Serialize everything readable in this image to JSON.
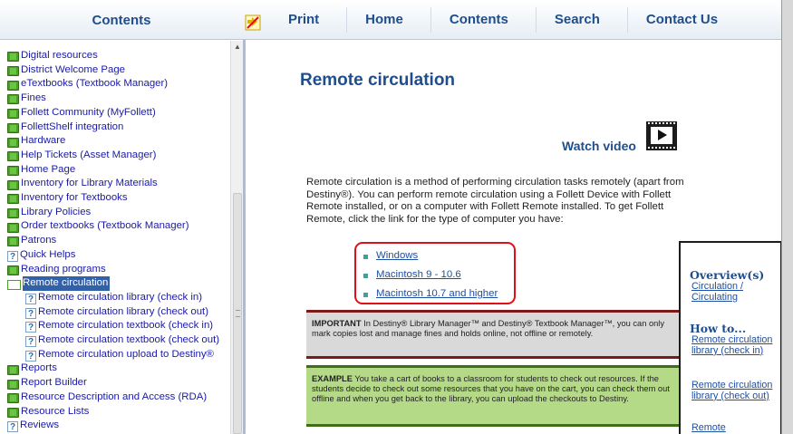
{
  "header": {
    "contents_label": "Contents",
    "nav": [
      "Print",
      "Home",
      "Contents",
      "Search",
      "Contact Us"
    ]
  },
  "sidebar": {
    "items": [
      {
        "label": "Digital resources",
        "icon": "book-icon",
        "level": 0
      },
      {
        "label": "District Welcome Page",
        "icon": "book-icon",
        "level": 0
      },
      {
        "label": "eTextbooks (Textbook Manager)",
        "icon": "book-icon",
        "level": 0
      },
      {
        "label": "Fines",
        "icon": "book-icon",
        "level": 0
      },
      {
        "label": "Follett Community (MyFollett)",
        "icon": "book-icon",
        "level": 0
      },
      {
        "label": "FollettShelf integration",
        "icon": "book-icon",
        "level": 0
      },
      {
        "label": "Hardware",
        "icon": "book-icon",
        "level": 0
      },
      {
        "label": "Help Tickets (Asset Manager)",
        "icon": "book-icon",
        "level": 0
      },
      {
        "label": "Home Page",
        "icon": "book-icon",
        "level": 0
      },
      {
        "label": "Inventory for Library Materials",
        "icon": "book-icon",
        "level": 0
      },
      {
        "label": "Inventory for Textbooks",
        "icon": "book-icon",
        "level": 0
      },
      {
        "label": "Library Policies",
        "icon": "book-icon",
        "level": 0
      },
      {
        "label": "Order textbooks (Textbook Manager)",
        "icon": "book-icon",
        "level": 0
      },
      {
        "label": "Patrons",
        "icon": "book-icon",
        "level": 0
      },
      {
        "label": "Quick Helps",
        "icon": "topic-icon",
        "level": 0
      },
      {
        "label": "Reading programs",
        "icon": "book-icon",
        "level": 0
      },
      {
        "label": "Remote circulation",
        "icon": "open-book-icon",
        "level": 0,
        "selected": true
      },
      {
        "label": "Remote circulation library (check in)",
        "icon": "topic-icon",
        "level": 1
      },
      {
        "label": "Remote circulation library (check out)",
        "icon": "topic-icon",
        "level": 1
      },
      {
        "label": "Remote circulation textbook (check in)",
        "icon": "topic-icon",
        "level": 1
      },
      {
        "label": "Remote circulation textbook (check out)",
        "icon": "topic-icon",
        "level": 1
      },
      {
        "label": "Remote circulation upload to Destiny®",
        "icon": "topic-icon",
        "level": 1
      },
      {
        "label": "Reports",
        "icon": "book-icon",
        "level": 0
      },
      {
        "label": "Report Builder",
        "icon": "book-icon",
        "level": 0
      },
      {
        "label": "Resource Description and Access (RDA)",
        "icon": "book-icon",
        "level": 0
      },
      {
        "label": "Resource Lists",
        "icon": "book-icon",
        "level": 0
      },
      {
        "label": "Reviews",
        "icon": "topic-icon",
        "level": 0
      }
    ]
  },
  "main": {
    "title": "Remote circulation",
    "watch_video": "Watch video",
    "intro": "Remote circulation is a method of performing circulation tasks remotely (apart from Destiny®). You can perform remote circulation using a Follett Device with Follett Remote installed, or on a computer with Follett Remote installed. To get Follett Remote, click the link for the type of computer you have:",
    "links": [
      "Windows",
      "Macintosh 9 - 10.6",
      "Macintosh 10.7 and higher"
    ],
    "important_label": "IMPORTANT",
    "important_text": "In Destiny® Library Manager™ and Destiny® Textbook Manager™, you can only mark copies lost and manage fines and holds online, not offline or remotely.",
    "example_label": "EXAMPLE",
    "example_text": "You take a cart of books to a classroom for students to check out resources. If the students decide to check out some resources that you have on the cart, you can check them out offline and when you get back to the library, you can upload the checkouts to Destiny."
  },
  "side_panel": {
    "overview_heading": "Overview(s)",
    "overview_link": "Circulation / Circulating",
    "howto_heading": "How to...",
    "howto_links": [
      "Remote circulation library (check in)",
      "Remote circulation library (check out)",
      "Remote"
    ]
  },
  "colors": {
    "accent": "#1f4e8c",
    "link": "#1d4fa3",
    "highlight_box": "#e0101a",
    "important_bg": "#d9d9d9",
    "example_bg": "#b4d987"
  }
}
